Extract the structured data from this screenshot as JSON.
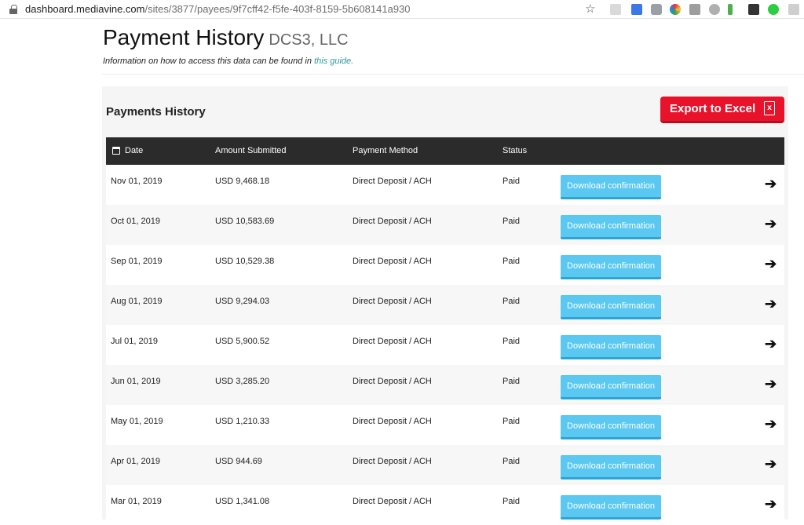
{
  "browser": {
    "url_domain": "dashboard.mediavine.com",
    "url_path": "/sites/3877/payees/9f7cff42-f5fe-403f-8159-5b608141a930"
  },
  "header": {
    "title": "Payment History",
    "company": "DCS3, LLC",
    "guide_text": "Information on how to access this data can be found in",
    "guide_link": "this guide."
  },
  "panel": {
    "title": "Payments History",
    "export_label": "Export to Excel",
    "excel_icon_glyph": "x"
  },
  "table": {
    "columns": [
      "Date",
      "Amount Submitted",
      "Payment Method",
      "Status"
    ],
    "download_label": "Download confirmation",
    "arrow_glyph": "➔",
    "rows": [
      {
        "date": "Nov 01, 2019",
        "amount": "USD 9,468.18",
        "method": "Direct Deposit / ACH",
        "status": "Paid"
      },
      {
        "date": "Oct 01, 2019",
        "amount": "USD 10,583.69",
        "method": "Direct Deposit / ACH",
        "status": "Paid"
      },
      {
        "date": "Sep 01, 2019",
        "amount": "USD 10,529.38",
        "method": "Direct Deposit / ACH",
        "status": "Paid"
      },
      {
        "date": "Aug 01, 2019",
        "amount": "USD 9,294.03",
        "method": "Direct Deposit / ACH",
        "status": "Paid"
      },
      {
        "date": "Jul 01, 2019",
        "amount": "USD 5,900.52",
        "method": "Direct Deposit / ACH",
        "status": "Paid"
      },
      {
        "date": "Jun 01, 2019",
        "amount": "USD 3,285.20",
        "method": "Direct Deposit / ACH",
        "status": "Paid"
      },
      {
        "date": "May 01, 2019",
        "amount": "USD 1,210.33",
        "method": "Direct Deposit / ACH",
        "status": "Paid"
      },
      {
        "date": "Apr 01, 2019",
        "amount": "USD 944.69",
        "method": "Direct Deposit / ACH",
        "status": "Paid"
      },
      {
        "date": "Mar 01, 2019",
        "amount": "USD 1,341.08",
        "method": "Direct Deposit / ACH",
        "status": "Paid"
      }
    ]
  },
  "colors": {
    "export_red": "#e8132b",
    "download_blue": "#5ac8f0",
    "header_dark": "#2b2b2b",
    "link_teal": "#2a9d9a"
  }
}
